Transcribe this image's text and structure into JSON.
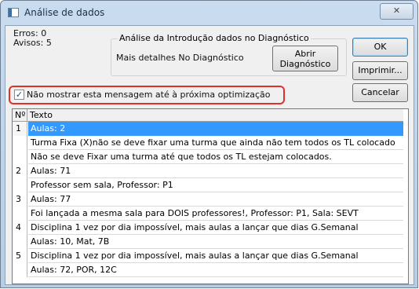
{
  "window": {
    "title": "Análise de dados",
    "close_glyph": "✕"
  },
  "summary": {
    "errors": "Erros: 0",
    "warnings": "Avisos: 5"
  },
  "diagnostic_group": {
    "title": "Análise da Introdução dados no Diagnóstico",
    "details_text": "Mais detalhes No Diagnóstico",
    "open_button_line1": "Abrir",
    "open_button_line2": "Diagnóstico"
  },
  "buttons": {
    "ok": "OK",
    "print": "Imprimir...",
    "cancel": "Cancelar"
  },
  "checkbox": {
    "label": "Não mostrar esta mensagem até à próxima optimização",
    "checked": true,
    "glyph": "✓"
  },
  "table": {
    "columns": [
      "Nº",
      "Texto"
    ],
    "rows": [
      {
        "num": "1",
        "text": "Aulas: 2",
        "selected": true
      },
      {
        "num": "",
        "text": "Turma Fixa (X)não se deve fixar uma turma que ainda não tem todos os TL colocado"
      },
      {
        "num": "",
        "text": "Não se deve Fixar uma turma até que todos os TL estejam colocados."
      },
      {
        "num": "2",
        "text": "Aulas: 71"
      },
      {
        "num": "",
        "text": "Professor sem sala, Professor: P1"
      },
      {
        "num": "3",
        "text": "Aulas: 77"
      },
      {
        "num": "",
        "text": "Foi lançada a mesma sala para DOIS professores!, Professor: P1, Sala: SEVT"
      },
      {
        "num": "4",
        "text": "Disciplina 1 vez por dia impossível, mais aulas a lançar que dias G.Semanal"
      },
      {
        "num": "",
        "text": "Aulas: 10, Mat, 7B"
      },
      {
        "num": "5",
        "text": "Disciplina 1 vez por dia impossível, mais aulas a lançar que dias G.Semanal"
      },
      {
        "num": "",
        "text": "Aulas: 72, POR, 12C"
      }
    ]
  }
}
